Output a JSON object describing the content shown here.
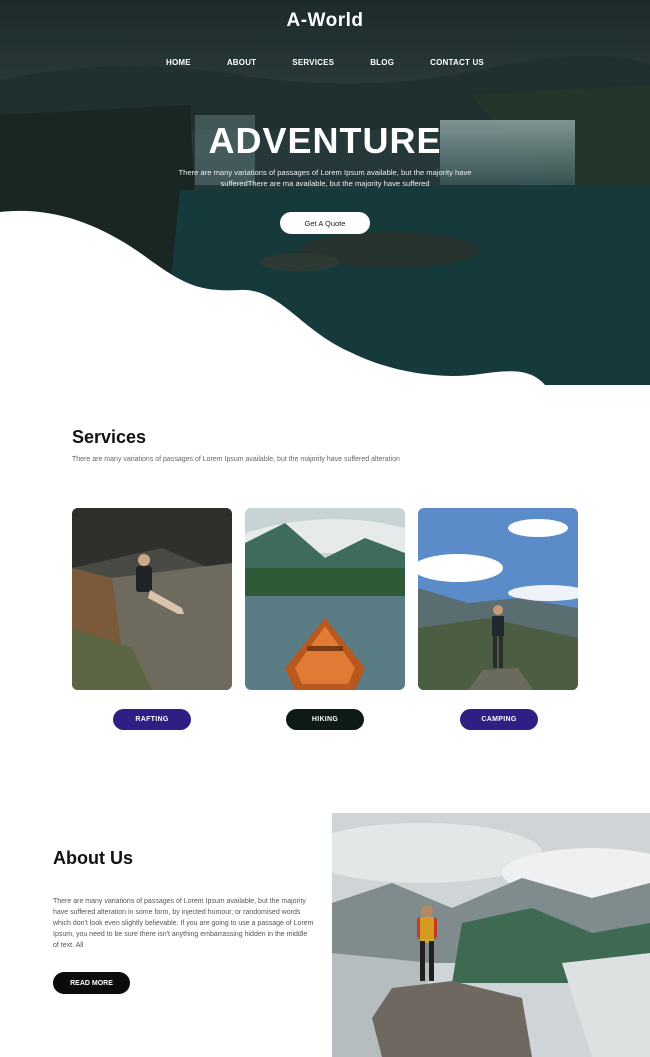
{
  "header": {
    "logo": "A-World",
    "nav": [
      "HOME",
      "ABOUT",
      "SERVICES",
      "BLOG",
      "CONTACT US"
    ]
  },
  "hero": {
    "title": "ADVENTURE",
    "text": "There are many variations of passages of Lorem Ipsum available, but the majority have sufferedThere are ma available, but the majority have suffered",
    "button": "Get A Quote"
  },
  "services": {
    "title": "Services",
    "text": "There are many variations of passages of Lorem Ipsum available, but the majority have suffered alteration",
    "cards": [
      {
        "label": "RAFTING",
        "color": "#2e1f85"
      },
      {
        "label": "HIKING",
        "color": "#0e1a17"
      },
      {
        "label": "CAMPING",
        "color": "#2e1f85"
      }
    ]
  },
  "about": {
    "title": "About Us",
    "text": "There are many variations of passages of Lorem Ipsum available, but the majority have suffered alteration in some form, by injected humour, or randomised words which don't look even slightly believable. If you are going to use a passage of Lorem Ipsum, you need to be sure there isn't anything embarrassing hidden in the middle of text. All",
    "button": "READ MORE"
  }
}
